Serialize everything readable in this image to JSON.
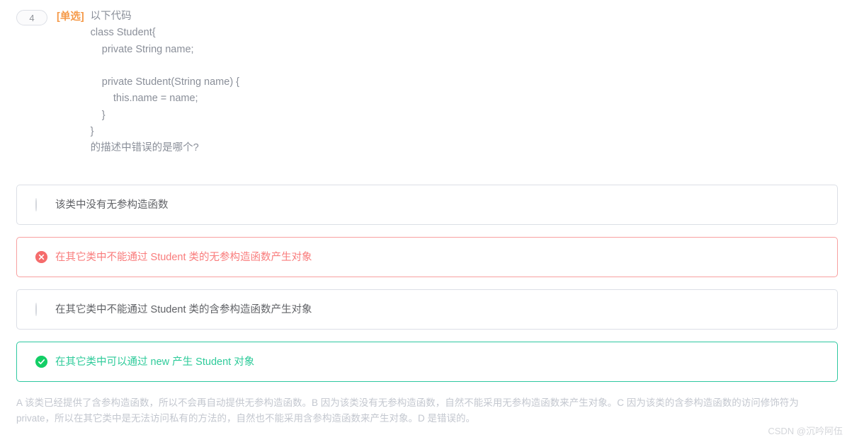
{
  "question": {
    "number": "4",
    "type_label": "[单选]",
    "title": "以下代码",
    "code": "class Student{\n    private String name;\n\n    private Student(String name) {\n        this.name = name;\n    }\n}",
    "tail": "的描述中错误的是哪个?"
  },
  "options": [
    {
      "icon": "radio-unselected-icon",
      "state": "normal",
      "label": "该类中没有无参构造函数"
    },
    {
      "icon": "circle-x-icon",
      "state": "wrong",
      "label": "在其它类中不能通过 Student 类的无参构造函数产生对象"
    },
    {
      "icon": "radio-unselected-icon",
      "state": "normal",
      "label": "在其它类中不能通过 Student 类的含参构造函数产生对象"
    },
    {
      "icon": "circle-check-icon",
      "state": "right",
      "label": "在其它类中可以通过 new 产生 Student 对象"
    }
  ],
  "explanation": "A 该类已经提供了含参构造函数，所以不会再自动提供无参构造函数。B 因为该类没有无参构造函数，自然不能采用无参构造函数来产生对象。C 因为该类的含参构造函数的访问修饰符为 private，所以在其它类中是无法访问私有的方法的，自然也不能采用含参构造函数来产生对象。D 是错误的。",
  "watermark": "CSDN @沉吟阿伍",
  "colors": {
    "accent_orange": "#f59a4a",
    "wrong_red": "#f56c6c",
    "right_green": "#13ce66",
    "text_grey": "#8a8f99",
    "border_grey": "#dcdfe6",
    "explanation_grey": "#c3c7cf"
  }
}
